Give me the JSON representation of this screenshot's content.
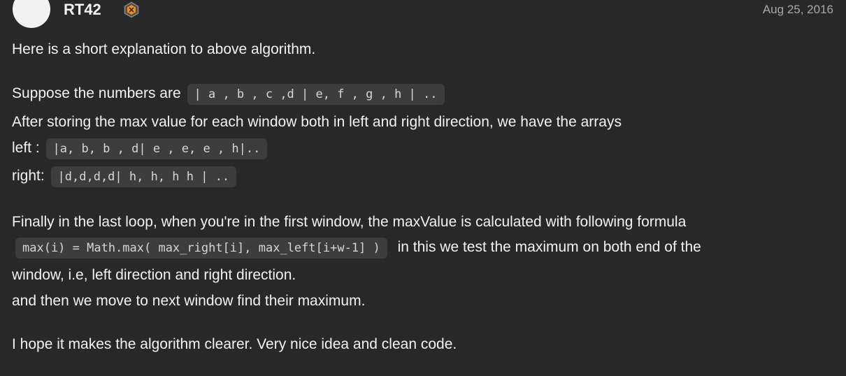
{
  "comment": {
    "author": "RT42",
    "date": "Aug 25, 2016",
    "badge_icon": "hexagon-badge-icon",
    "paragraph_intro": "Here is a short explanation to above algorithm.",
    "suppose_text": "Suppose the numbers are",
    "suppose_code": "| a , b , c ,d | e, f , g , h | ..",
    "after_text": "After storing the max value for each window both in left and right direction, we have the arrays",
    "left_label": "left :",
    "left_code": "|a, b, b , d| e , e, e , h|..",
    "right_label": "right:",
    "right_code": "|d,d,d,d| h, h, h h | ..",
    "finally_text": "Finally in the last loop, when you're in the first window, the maxValue is calculated with following formula",
    "formula_code": "max(i) = Math.max( max_right[i], max_left[i+w-1] )",
    "formula_after": "in this we test the maximum on both end of the",
    "window_text": "window, i.e, left direction and right direction.",
    "then_text": "and then we move to next window find their maximum.",
    "hope_text": "I hope it makes the algorithm clearer. Very nice idea and clean code."
  },
  "colors": {
    "background": "#282828",
    "text": "#f2f2f2",
    "muted": "#a8a8a8",
    "code_bg": "#3d3d3d",
    "badge_orange": "#e8922f"
  }
}
